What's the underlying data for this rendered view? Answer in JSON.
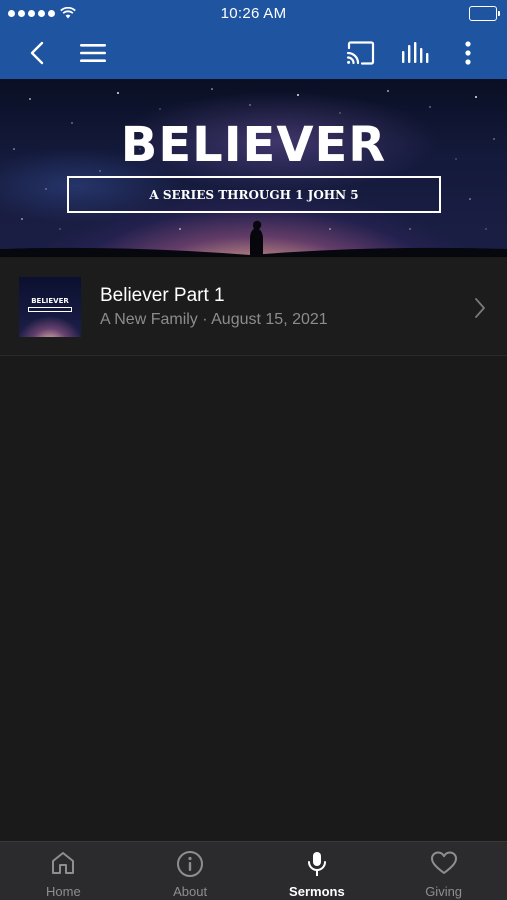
{
  "status_bar": {
    "time": "10:26 AM"
  },
  "nav": {
    "back_icon": "chevron-left-icon",
    "menu_icon": "hamburger-menu-icon",
    "cast_icon": "cast-icon",
    "audio_icon": "audio-levels-icon",
    "more_icon": "more-vertical-icon"
  },
  "hero": {
    "title": "BELIEVER",
    "subtitle": "A SERIES THROUGH 1 JOHN 5"
  },
  "sermons": [
    {
      "thumb_title": "BELIEVER",
      "title": "Believer Part 1",
      "subtitle": "A New Family · August 15, 2021"
    }
  ],
  "tabs": [
    {
      "label": "Home",
      "icon": "home-icon",
      "active": false
    },
    {
      "label": "About",
      "icon": "info-icon",
      "active": false
    },
    {
      "label": "Sermons",
      "icon": "microphone-icon",
      "active": true
    },
    {
      "label": "Giving",
      "icon": "heart-icon",
      "active": false
    }
  ],
  "colors": {
    "nav_blue": "#1e54a0",
    "background": "#1a1a1b",
    "tab_bar": "#2b2b2d",
    "muted_text": "#8c8c8e"
  }
}
